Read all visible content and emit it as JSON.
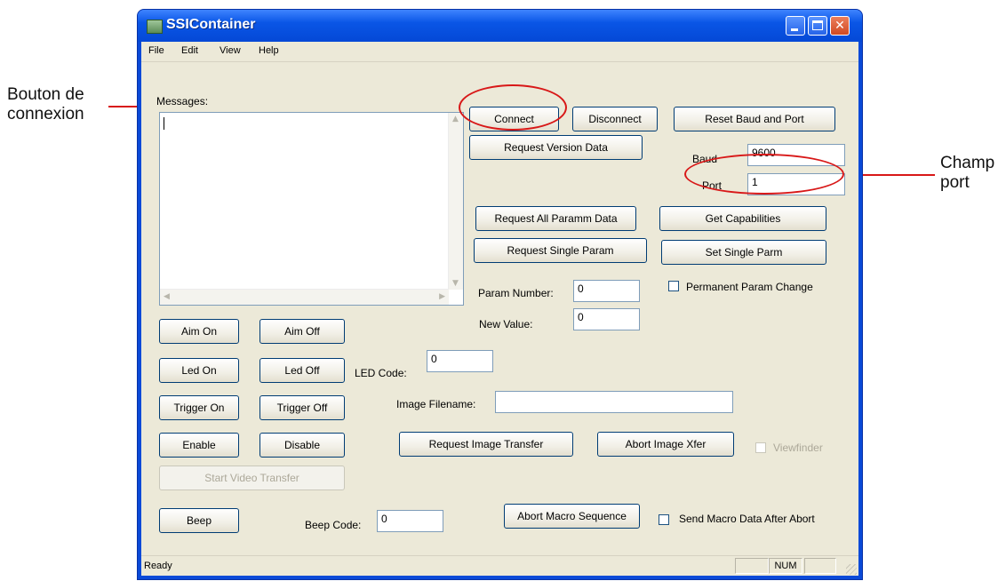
{
  "annotations": {
    "left_label_line1": "Bouton de",
    "left_label_line2": "connexion",
    "right_label_line1": "Champ",
    "right_label_line2": "port",
    "accent_color": "#d81818"
  },
  "window": {
    "title": "SSIContainer",
    "minimize_glyph": "",
    "close_glyph": "✕"
  },
  "menu": {
    "file": "File",
    "edit": "Edit",
    "view": "View",
    "help": "Help"
  },
  "messages": {
    "label": "Messages:"
  },
  "connection": {
    "connect": "Connect",
    "disconnect": "Disconnect",
    "reset": "Reset Baud and Port",
    "request_version": "Request Version Data",
    "baud_label": "Baud",
    "baud_value": "9600",
    "port_label": "Port",
    "port_value": "1"
  },
  "params": {
    "request_all": "Request All Paramm Data",
    "get_capabilities": "Get Capabilities",
    "request_single": "Request Single Param",
    "set_single": "Set Single Parm",
    "param_number_label": "Param Number:",
    "param_number_value": "0",
    "permanent_change": "Permanent Param Change",
    "new_value_label": "New Value:",
    "new_value_value": "0"
  },
  "controls": {
    "aim_on": "Aim On",
    "aim_off": "Aim Off",
    "led_on": "Led On",
    "led_off": "Led Off",
    "led_code_label": "LED Code:",
    "led_code_value": "0",
    "trigger_on": "Trigger On",
    "trigger_off": "Trigger Off",
    "enable": "Enable",
    "disable": "Disable",
    "start_video": "Start Video Transfer",
    "beep": "Beep",
    "beep_code_label": "Beep Code:",
    "beep_code_value": "0"
  },
  "image": {
    "filename_label": "Image Filename:",
    "filename_value": "",
    "request_transfer": "Request Image Transfer",
    "abort_xfer": "Abort Image Xfer",
    "viewfinder": "Viewfinder"
  },
  "macro": {
    "abort_sequence": "Abort Macro Sequence",
    "send_after_abort": "Send Macro Data After Abort"
  },
  "status": {
    "text": "Ready",
    "num": "NUM"
  }
}
